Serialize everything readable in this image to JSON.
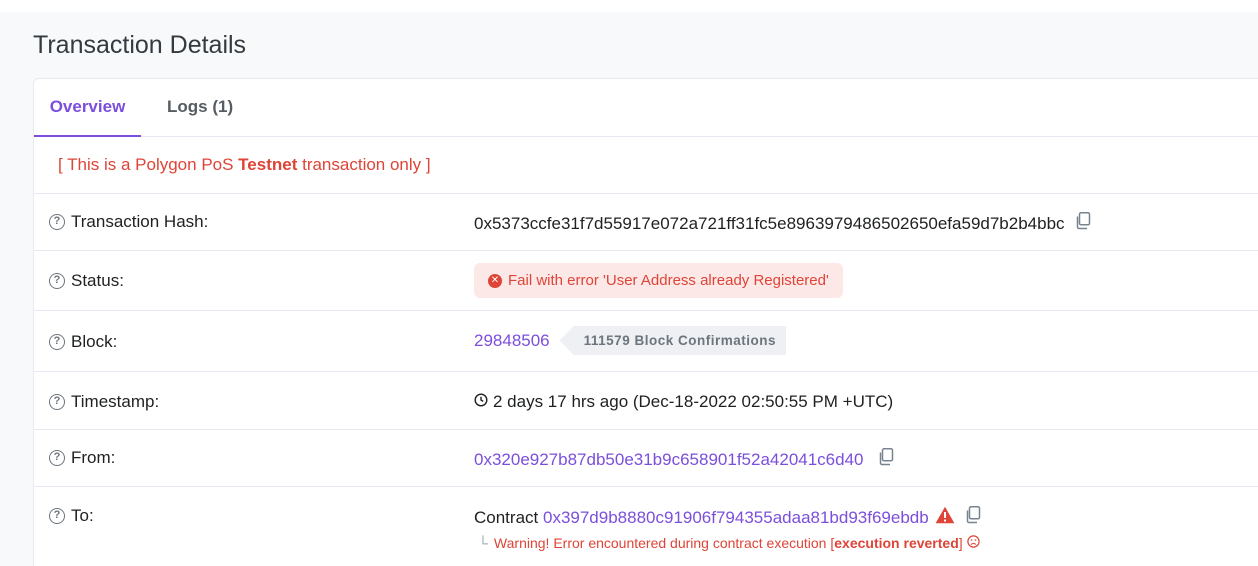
{
  "page": {
    "title": "Transaction Details"
  },
  "tabs": [
    {
      "label": "Overview",
      "active": true
    },
    {
      "label": "Logs (1)",
      "active": false
    }
  ],
  "notice": {
    "prefix": "[ This is a Polygon PoS ",
    "bold": "Testnet",
    "suffix": " transaction only ]"
  },
  "rows": {
    "hash": {
      "label": "Transaction Hash:",
      "value": "0x5373ccfe31f7d55917e072a721ff31fc5e8963979486502650efa59d7b2b4bbc"
    },
    "status": {
      "label": "Status:",
      "value": "Fail with error 'User Address already Registered'"
    },
    "block": {
      "label": "Block:",
      "number": "29848506",
      "confirmations": "111579 Block Confirmations"
    },
    "timestamp": {
      "label": "Timestamp:",
      "value": "2 days 17 hrs ago (Dec-18-2022 02:50:55 PM +UTC)"
    },
    "from": {
      "label": "From:",
      "address": "0x320e927b87db50e31b9c658901f52a42041c6d40"
    },
    "to": {
      "label": "To:",
      "prefix": "Contract ",
      "address": "0x397d9b8880c91906f794355adaa81bd93f69ebdb",
      "warning_prefix": "Warning! Error encountered during contract execution [",
      "warning_bold": "execution reverted",
      "warning_suffix": "]"
    }
  },
  "colors": {
    "accent": "#7b4fdb",
    "error": "#de4437",
    "error_bg": "#fde8e8"
  },
  "icons": {
    "help": "question-circle-icon",
    "copy": "copy-icon",
    "fail": "times-circle-icon",
    "clock": "clock-icon",
    "warning": "warning-triangle-icon",
    "sad": "frown-icon"
  }
}
